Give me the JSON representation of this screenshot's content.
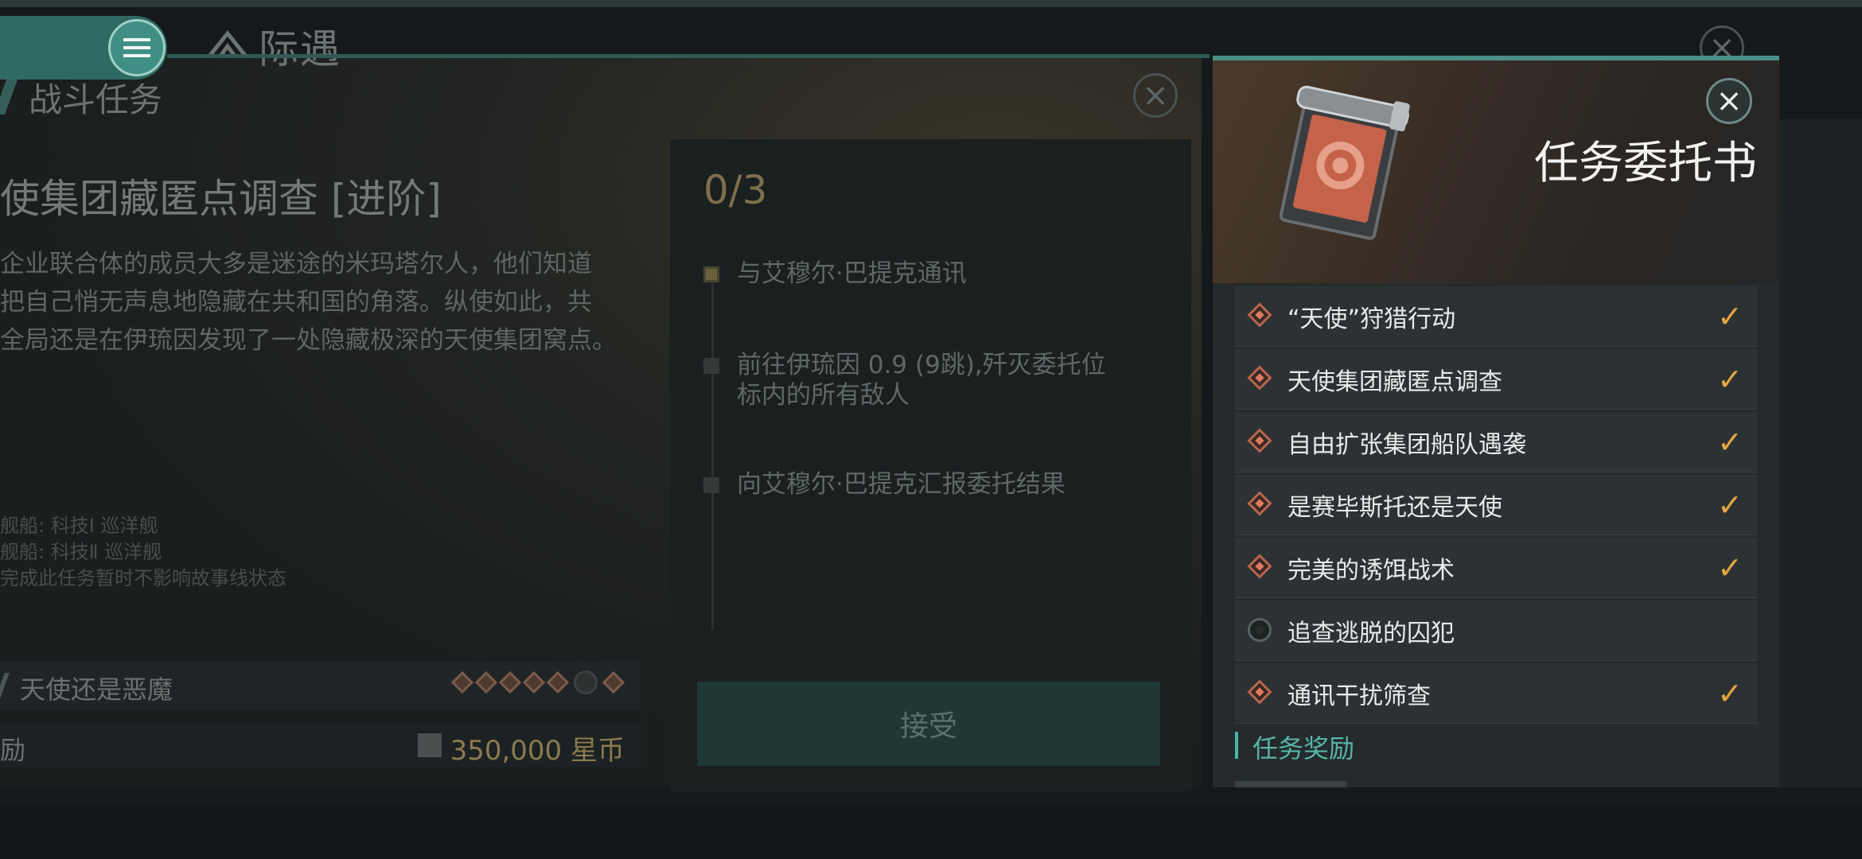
{
  "header": {
    "brand_title": "际遇",
    "section_title": "战斗任务"
  },
  "mission": {
    "name": "使集团藏匿点调查 [进阶]",
    "description_lines": [
      "企业联合体的成员大多是迷途的米玛塔尔人，他们知道",
      "把自己悄无声息地隐藏在共和国的角落。纵使如此，共",
      "全局还是在伊琉因发现了一处隐藏极深的天使集团窝点。"
    ],
    "ship_lines": [
      "舰船: 科技Ⅰ 巡洋舰",
      "舰船: 科技Ⅱ 巡洋舰",
      "完成此任务暂时不影响故事线状态"
    ],
    "chain_label": "天使还是恶魔",
    "reward_label": "励",
    "reward_amount": "350,000 星币"
  },
  "objectives": {
    "count": "0/3",
    "items": [
      {
        "text": "与艾穆尔·巴提克通讯",
        "active": true
      },
      {
        "text": "前往伊琉因 0.9 (9跳),歼灭委托位标内的所有敌人",
        "active": false
      },
      {
        "text": "向艾穆尔·巴提克汇报委托结果",
        "active": false
      }
    ],
    "accept_label": "接受"
  },
  "commission": {
    "title": "任务委托书",
    "items": [
      {
        "label": "“天使”狩猎行动",
        "done": true
      },
      {
        "label": "天使集团藏匿点调查",
        "done": true
      },
      {
        "label": "自由扩张集团船队遇袭",
        "done": true
      },
      {
        "label": "是赛毕斯托还是天使",
        "done": true
      },
      {
        "label": "完美的诱饵战术",
        "done": true
      },
      {
        "label": "追查逃脱的囚犯",
        "done": false
      },
      {
        "label": "通讯干扰筛查",
        "done": true
      }
    ],
    "reward_heading": "任务奖励"
  },
  "colors": {
    "accent_teal": "#48b5a3",
    "check_gold": "#e5a640",
    "diamond_orange": "#e07a5c"
  },
  "icons": {
    "menu": "hamburger-icon",
    "close": "close-icon",
    "check": "check-icon",
    "diamond": "diamond-bullet-icon",
    "pending": "circle-pending-icon",
    "currency": "isk-currency-icon"
  }
}
